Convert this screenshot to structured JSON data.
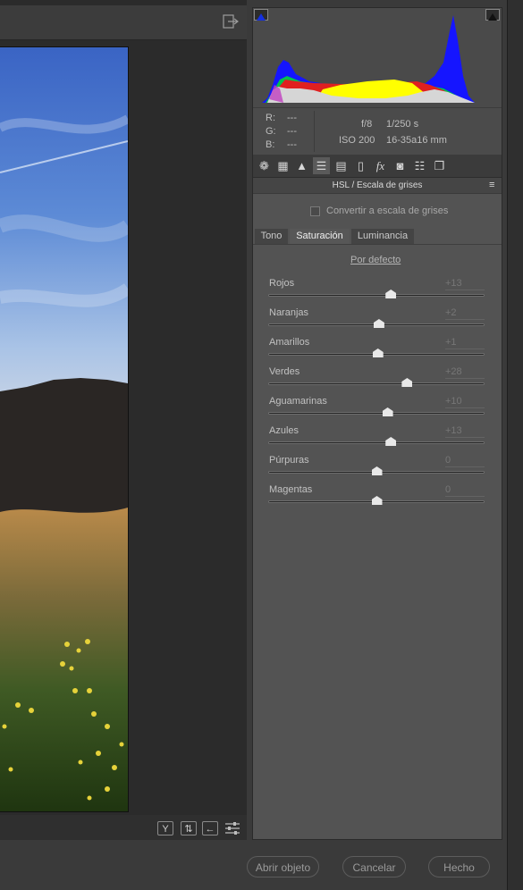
{
  "histogram": {
    "shadow_clip_icon": "triangle-icon",
    "highlight_clip_icon": "triangle-icon"
  },
  "info": {
    "r_label": "R:",
    "r_value": "---",
    "g_label": "G:",
    "g_value": "---",
    "b_label": "B:",
    "b_value": "---",
    "aperture": "f/8",
    "shutter": "1/250 s",
    "iso": "ISO 200",
    "lens": "16-35a16 mm"
  },
  "panel": {
    "title": "HSL / Escala de grises",
    "grayscale_label": "Convertir a escala de grises",
    "tabs": [
      "Tono",
      "Saturación",
      "Luminancia"
    ],
    "active_tab": "Saturación",
    "default_link": "Por defecto",
    "sliders": [
      {
        "label": "Rojos",
        "value": "+13",
        "level": 13
      },
      {
        "label": "Naranjas",
        "value": "+2",
        "level": 2
      },
      {
        "label": "Amarillos",
        "value": "+1",
        "level": 1
      },
      {
        "label": "Verdes",
        "value": "+28",
        "level": 28
      },
      {
        "label": "Aguamarinas",
        "value": "+10",
        "level": 10
      },
      {
        "label": "Azules",
        "value": "+13",
        "level": 13
      },
      {
        "label": "Púrpuras",
        "value": "0",
        "level": 0
      },
      {
        "label": "Magentas",
        "value": "0",
        "level": 0
      }
    ]
  },
  "footer": {
    "open_label": "Abrir objeto",
    "cancel_label": "Cancelar",
    "done_label": "Hecho"
  },
  "preview_bottom": {
    "y_label": "Y"
  }
}
